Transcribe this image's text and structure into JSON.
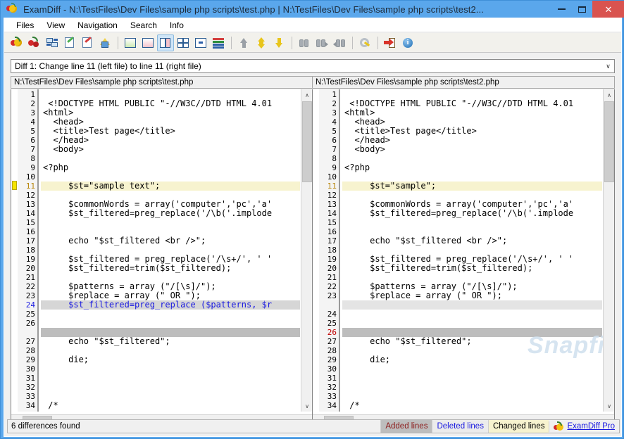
{
  "window": {
    "title": "ExamDiff - N:\\TestFiles\\Dev Files\\sample php scripts\\test.php  |  N:\\TestFiles\\Dev Files\\sample php scripts\\test2...",
    "minimize_label": "–",
    "maximize_label": "❐",
    "close_label": "✕"
  },
  "menu": {
    "items": [
      {
        "label": "Files"
      },
      {
        "label": "View"
      },
      {
        "label": "Navigation"
      },
      {
        "label": "Search"
      },
      {
        "label": "Info"
      }
    ]
  },
  "toolbar": {
    "buttons": [
      {
        "name": "compare-files-icon",
        "tip": "Compare Files"
      },
      {
        "name": "compare-directories-icon",
        "tip": "Compare Directories"
      },
      {
        "name": "recompare-icon",
        "tip": "Recompare"
      },
      {
        "name": "edit-left-file-icon",
        "tip": "Edit Left File"
      },
      {
        "name": "edit-right-file-icon",
        "tip": "Edit Right File"
      },
      {
        "name": "save-icon",
        "tip": "Save"
      },
      {
        "name": "view-left-only-icon",
        "tip": "View Left File Only"
      },
      {
        "name": "view-right-only-icon",
        "tip": "View Right File Only"
      },
      {
        "name": "view-side-by-side-icon",
        "tip": "Side by Side View"
      },
      {
        "name": "view-grid-icon",
        "tip": "Grid View"
      },
      {
        "name": "view-horizontal-split-icon",
        "tip": "Horizontal Split View"
      },
      {
        "name": "view-stacked-icon",
        "tip": "Stacked View"
      },
      {
        "name": "first-difference-icon",
        "tip": "First Difference"
      },
      {
        "name": "next-difference-icon",
        "tip": "Next Difference"
      },
      {
        "name": "previous-difference-icon",
        "tip": "Previous Difference"
      },
      {
        "name": "find-icon",
        "tip": "Find"
      },
      {
        "name": "find-next-icon",
        "tip": "Find Next"
      },
      {
        "name": "find-previous-icon",
        "tip": "Find Previous"
      },
      {
        "name": "options-icon",
        "tip": "Options"
      },
      {
        "name": "exit-icon",
        "tip": "Exit"
      },
      {
        "name": "about-icon",
        "tip": "About"
      }
    ]
  },
  "diff_selector": {
    "value": "Diff 1: Change line 11 (left file) to line 11 (right file)",
    "chevron": "∨"
  },
  "left_pane": {
    "file_path": "N:\\TestFiles\\Dev Files\\sample php scripts\\test.php",
    "scroll_up": "∧",
    "scroll_down": "∨",
    "scroll_left": "‹",
    "scroll_right": "›",
    "lines": [
      {
        "num": "1",
        "text": "",
        "type": "normal"
      },
      {
        "num": "2",
        "text": " <!DOCTYPE HTML PUBLIC \"-//W3C//DTD HTML 4.01",
        "type": "normal"
      },
      {
        "num": "3",
        "text": "<html>",
        "type": "normal"
      },
      {
        "num": "4",
        "text": "  <head>",
        "type": "normal"
      },
      {
        "num": "5",
        "text": "  <title>Test page</title>",
        "type": "normal"
      },
      {
        "num": "6",
        "text": "  </head>",
        "type": "normal"
      },
      {
        "num": "7",
        "text": "  <body>",
        "type": "normal"
      },
      {
        "num": "8",
        "text": "",
        "type": "normal"
      },
      {
        "num": "9",
        "text": "<?php",
        "type": "normal"
      },
      {
        "num": "10",
        "text": "",
        "type": "normal"
      },
      {
        "num": "11",
        "text": "     $st=\"sample text\";",
        "type": "changed"
      },
      {
        "num": "12",
        "text": "",
        "type": "normal"
      },
      {
        "num": "13",
        "text": "     $commonWords = array('computer','pc','a'",
        "type": "normal"
      },
      {
        "num": "14",
        "text": "     $st_filtered=preg_replace('/\\b('.implode",
        "type": "normal"
      },
      {
        "num": "15",
        "text": "",
        "type": "normal"
      },
      {
        "num": "16",
        "text": "",
        "type": "normal"
      },
      {
        "num": "17",
        "text": "     echo \"$st_filtered <br />\";",
        "type": "normal"
      },
      {
        "num": "18",
        "text": "",
        "type": "normal"
      },
      {
        "num": "19",
        "text": "     $st_filtered = preg_replace('/\\s+/', ' '",
        "type": "normal"
      },
      {
        "num": "20",
        "text": "     $st_filtered=trim($st_filtered);",
        "type": "normal"
      },
      {
        "num": "21",
        "text": "",
        "type": "normal"
      },
      {
        "num": "22",
        "text": "     $patterns = array (\"/[\\s]/\");",
        "type": "normal"
      },
      {
        "num": "23",
        "text": "     $replace = array (\" OR \");",
        "type": "normal"
      },
      {
        "num": "24",
        "text": "     $st_filtered=preg_replace ($patterns, $r",
        "type": "added"
      },
      {
        "num": "25",
        "text": "",
        "type": "normal"
      },
      {
        "num": "26",
        "text": "",
        "type": "normal"
      },
      {
        "num": "",
        "text": "",
        "type": "gap-deleted"
      },
      {
        "num": "27",
        "text": "     echo \"$st_filtered\";",
        "type": "normal"
      },
      {
        "num": "28",
        "text": "",
        "type": "normal"
      },
      {
        "num": "29",
        "text": "     die;",
        "type": "normal"
      },
      {
        "num": "30",
        "text": "",
        "type": "normal"
      },
      {
        "num": "31",
        "text": "",
        "type": "normal"
      },
      {
        "num": "32",
        "text": "",
        "type": "normal"
      },
      {
        "num": "33",
        "text": "",
        "type": "normal"
      },
      {
        "num": "34",
        "text": " /*",
        "type": "normal"
      }
    ]
  },
  "right_pane": {
    "file_path": "N:\\TestFiles\\Dev Files\\sample php scripts\\test2.php",
    "scroll_up": "∧",
    "scroll_down": "∨",
    "scroll_left": "‹",
    "scroll_right": "›",
    "lines": [
      {
        "num": "1",
        "text": "",
        "type": "normal"
      },
      {
        "num": "2",
        "text": " <!DOCTYPE HTML PUBLIC \"-//W3C//DTD HTML 4.01",
        "type": "normal"
      },
      {
        "num": "3",
        "text": "<html>",
        "type": "normal"
      },
      {
        "num": "4",
        "text": "  <head>",
        "type": "normal"
      },
      {
        "num": "5",
        "text": "  <title>Test page</title>",
        "type": "normal"
      },
      {
        "num": "6",
        "text": "  </head>",
        "type": "normal"
      },
      {
        "num": "7",
        "text": "  <body>",
        "type": "normal"
      },
      {
        "num": "8",
        "text": "",
        "type": "normal"
      },
      {
        "num": "9",
        "text": "<?php",
        "type": "normal"
      },
      {
        "num": "10",
        "text": "",
        "type": "normal"
      },
      {
        "num": "11",
        "text": "     $st=\"sample\";",
        "type": "changed"
      },
      {
        "num": "12",
        "text": "",
        "type": "normal"
      },
      {
        "num": "13",
        "text": "     $commonWords = array('computer','pc','a'",
        "type": "normal"
      },
      {
        "num": "14",
        "text": "     $st_filtered=preg_replace('/\\b('.implode",
        "type": "normal"
      },
      {
        "num": "15",
        "text": "",
        "type": "normal"
      },
      {
        "num": "16",
        "text": "",
        "type": "normal"
      },
      {
        "num": "17",
        "text": "     echo \"$st_filtered <br />\";",
        "type": "normal"
      },
      {
        "num": "18",
        "text": "",
        "type": "normal"
      },
      {
        "num": "19",
        "text": "     $st_filtered = preg_replace('/\\s+/', ' '",
        "type": "normal"
      },
      {
        "num": "20",
        "text": "     $st_filtered=trim($st_filtered);",
        "type": "normal"
      },
      {
        "num": "21",
        "text": "",
        "type": "normal"
      },
      {
        "num": "22",
        "text": "     $patterns = array (\"/[\\s]/\");",
        "type": "normal"
      },
      {
        "num": "23",
        "text": "     $replace = array (\" OR \");",
        "type": "normal"
      },
      {
        "num": "",
        "text": "",
        "type": "gap-added"
      },
      {
        "num": "24",
        "text": "",
        "type": "normal"
      },
      {
        "num": "25",
        "text": "",
        "type": "normal"
      },
      {
        "num": "26",
        "text": "",
        "type": "deleted"
      },
      {
        "num": "27",
        "text": "     echo \"$st_filtered\";",
        "type": "normal"
      },
      {
        "num": "28",
        "text": "",
        "type": "normal"
      },
      {
        "num": "29",
        "text": "     die;",
        "type": "normal"
      },
      {
        "num": "30",
        "text": "",
        "type": "normal"
      },
      {
        "num": "31",
        "text": "",
        "type": "normal"
      },
      {
        "num": "32",
        "text": "",
        "type": "normal"
      },
      {
        "num": "33",
        "text": "",
        "type": "normal"
      },
      {
        "num": "34",
        "text": " /*",
        "type": "normal"
      }
    ]
  },
  "watermark": {
    "text": "Snapfiles"
  },
  "statusbar": {
    "message": "6 differences found",
    "added_label": "Added lines",
    "deleted_label": "Deleted lines",
    "changed_label": "Changed lines",
    "brand_label": "ExamDiff Pro"
  },
  "colors": {
    "title_bar": "#5aa7ec",
    "close_button": "#d9534f",
    "changed_line_bg": "#f7f3cf",
    "added_line_bg": "#d6d6d6",
    "deleted_line_bg": "#bdbdbd",
    "added_text": "#1a1ae0",
    "changed_linenum": "#b8860b",
    "deleted_linenum": "#c00000",
    "toolbar_bg": "#f2f1ec"
  }
}
